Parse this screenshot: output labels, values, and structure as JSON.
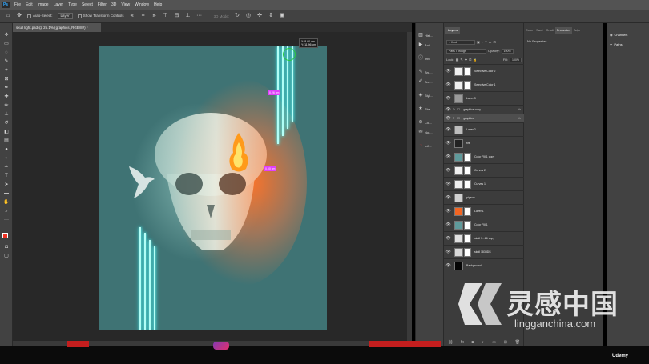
{
  "app": {
    "logo": "Ps",
    "menu": [
      "File",
      "Edit",
      "Image",
      "Layer",
      "Type",
      "Select",
      "Filter",
      "3D",
      "View",
      "Window",
      "Help"
    ]
  },
  "options_bar": {
    "auto_select_label": "Auto-Select:",
    "auto_select_value": "Layer",
    "show_transform_label": "Show Transform Controls",
    "mode_3d_label": "3D Mode:"
  },
  "document": {
    "tab_title": "skull light.psd @ 25.1% (graphics, RGB/8#) *",
    "coord_readout": [
      "X: 8.00 cm",
      "Y: 11.96 cm"
    ],
    "magenta_tags": [
      "0.26 cm",
      "0.00 cm"
    ]
  },
  "collapsed_panels": [
    {
      "label": "Hist...",
      "icon": "histogram-icon"
    },
    {
      "label": "Acti...",
      "icon": "actions-icon"
    },
    {
      "label": "Info",
      "icon": "info-icon"
    },
    {
      "label": "Bru...",
      "icon": "brush-icon"
    },
    {
      "label": "Bru...",
      "icon": "brush-settings-icon"
    },
    {
      "label": "Styl...",
      "icon": "styles-icon"
    },
    {
      "label": "Sha...",
      "icon": "shapes-icon"
    },
    {
      "label": "Clo...",
      "icon": "clone-source-icon"
    },
    {
      "label": "Not...",
      "icon": "notes-icon"
    },
    {
      "label": "Infi...",
      "icon": "info-red-icon"
    }
  ],
  "layers_panel": {
    "tab": "Layers",
    "kind_filter": "Kind",
    "blend_mode": "Pass Through",
    "opacity_label": "Opacity:",
    "opacity_value": "100%",
    "lock_label": "Lock:",
    "fill_label": "Fill:",
    "fill_value": "100%",
    "layers": [
      {
        "name": "Selective Color 2",
        "thumb": "#f0f0f0",
        "mask": true,
        "fx": "",
        "kind": "layer"
      },
      {
        "name": "Selective Color 1",
        "thumb": "#f0f0f0",
        "mask": true,
        "fx": "",
        "kind": "layer"
      },
      {
        "name": "Layer 3",
        "thumb": "#9a9a9a",
        "mask": false,
        "fx": "",
        "kind": "layer"
      },
      {
        "name": "graphics copy",
        "thumb": "",
        "mask": false,
        "fx": "fx",
        "kind": "group"
      },
      {
        "name": "graphics",
        "thumb": "",
        "mask": false,
        "fx": "fx",
        "kind": "group",
        "selected": true
      },
      {
        "name": "Layer 2",
        "thumb": "#bdbdbd",
        "mask": false,
        "fx": "",
        "kind": "layer"
      },
      {
        "name": "fire",
        "thumb": "#222222",
        "mask": false,
        "fx": "",
        "kind": "layer"
      },
      {
        "name": "Color Fill 1 copy",
        "thumb": "#5f9a9b",
        "mask": true,
        "fx": "",
        "kind": "layer"
      },
      {
        "name": "Curves 2",
        "thumb": "#f0f0f0",
        "mask": true,
        "fx": "",
        "kind": "layer"
      },
      {
        "name": "Curves 1",
        "thumb": "#f0f0f0",
        "mask": true,
        "fx": "",
        "kind": "layer"
      },
      {
        "name": "pigeon",
        "thumb": "#cfcfcf",
        "mask": false,
        "fx": "",
        "kind": "layer"
      },
      {
        "name": "Layer 1",
        "thumb": "#f26522",
        "mask": true,
        "fx": "",
        "kind": "layer"
      },
      {
        "name": "Color Fill 1",
        "thumb": "#5f9a9b",
        "mask": true,
        "fx": "",
        "kind": "layer"
      },
      {
        "name": "skull 1...26 copy",
        "thumb": "#e0e0e0",
        "mask": true,
        "fx": "",
        "kind": "layer"
      },
      {
        "name": "skull 1838DS",
        "thumb": "#d8d8d8",
        "mask": true,
        "fx": "",
        "kind": "layer"
      },
      {
        "name": "Background",
        "thumb": "#050505",
        "mask": false,
        "fx": "",
        "kind": "layer"
      }
    ]
  },
  "properties_panel": {
    "tabs": [
      "Color",
      "Swat",
      "Gradi",
      "Properties",
      "Adju"
    ],
    "active": "Properties",
    "content": "No Properties"
  },
  "right_panels": [
    {
      "label": "Channels",
      "icon": "channels-icon"
    },
    {
      "label": "Paths",
      "icon": "paths-icon"
    }
  ],
  "watermark": {
    "cn": "灵感中国",
    "en": "lingganchina.com"
  },
  "udemy_label": "Udemy",
  "colors": {
    "canvas_bg": "#3f7374",
    "foreground": "#ee3324",
    "background": "#f26522",
    "neon": "#b6fff7"
  }
}
